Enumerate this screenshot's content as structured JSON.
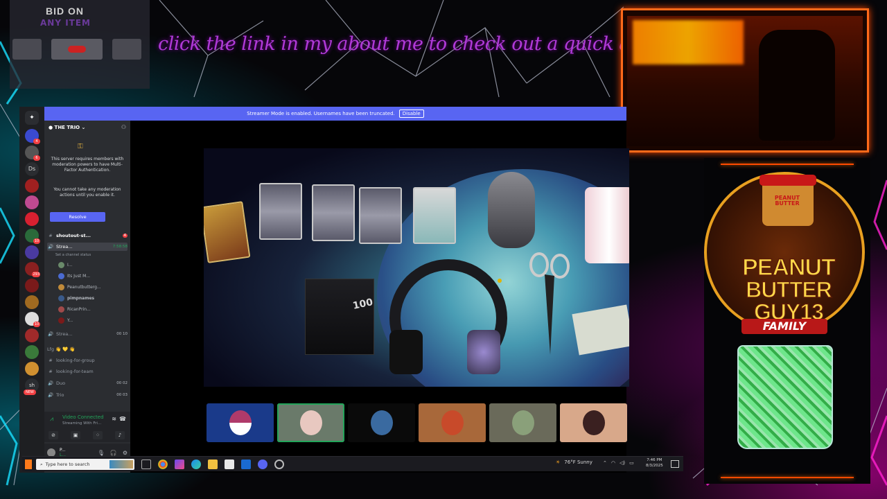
{
  "overlay": {
    "bid_title": "BID ON",
    "bid_subtitle": "ANY ITEM",
    "marquee": "click the link in my about me to check out a quick an easy come up!"
  },
  "discord": {
    "streamer_mode_text": "Streamer Mode is enabled. Usernames have been truncated.",
    "disable_label": "Disable",
    "server_name": "THE TRIO",
    "mfa_text_1": "This server requires members with moderation powers to have Multi-Factor Authentication.",
    "mfa_text_2": "You cannot take any moderation actions until you enable it.",
    "resolve_label": "Resolve",
    "guild_short": "Ds",
    "guild_short_2": "sh",
    "guild_new": "NEW",
    "channels": [
      {
        "symbol": "#",
        "name": "shoutout-st...",
        "right": "4"
      },
      {
        "symbol": "🔊",
        "name": "Strea...",
        "right": "7:58:58"
      },
      {
        "symbol": "",
        "name": "Set a channel status",
        "right": ""
      }
    ],
    "voice_users": [
      "I...",
      "Its Just M...",
      "Peanutbutterg...",
      "pimpnames",
      "RicanPrin...",
      "Y..."
    ],
    "more_channels": [
      {
        "symbol": "🔊",
        "name": "Strea...",
        "right": "00 10"
      },
      {
        "symbol": "",
        "name": "Lfg 👋 💛 👋",
        "right": ""
      },
      {
        "symbol": "#",
        "name": "looking-for-group",
        "right": ""
      },
      {
        "symbol": "#",
        "name": "looking-for-team",
        "right": ""
      },
      {
        "symbol": "🔊",
        "name": "Duo",
        "right": "00 02"
      },
      {
        "symbol": "🔊",
        "name": "Trio",
        "right": "00 03"
      }
    ],
    "voice_connected": "Video Connected",
    "voice_sub": "Streaming With Fri...",
    "user_name": "P...",
    "user_sub": "L..."
  },
  "taskbar": {
    "search_placeholder": "Type here to search",
    "weather": "76°F  Sunny",
    "time": "7:46 PM",
    "date": "8/3/2025"
  },
  "brand": {
    "jar_label": "PEANUT BUTTER",
    "line1": "PEANUT",
    "line2": "BUTTER",
    "line3": "GUY13",
    "family": "FAMILY"
  },
  "colors": {
    "accent_orange": "#ff6a1a",
    "discord_blurple": "#5865f2",
    "voice_green": "#23a55a"
  }
}
